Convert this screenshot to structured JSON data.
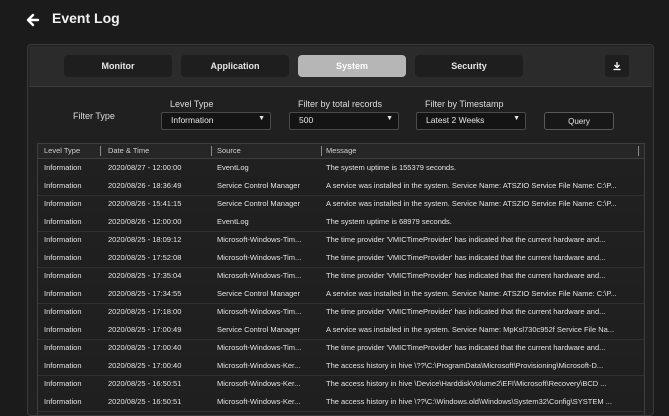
{
  "header": {
    "title": "Event Log"
  },
  "tabs": [
    {
      "label": "Monitor",
      "active": false
    },
    {
      "label": "Application",
      "active": false
    },
    {
      "label": "System",
      "active": true
    },
    {
      "label": "Security",
      "active": false
    }
  ],
  "filters": {
    "filter_type_label": "Filter Type",
    "level_type": {
      "label": "Level Type",
      "value": "Information"
    },
    "total_records": {
      "label": "Filter by total records",
      "value": "500"
    },
    "timestamp": {
      "label": "Filter by Timestamp",
      "value": "Latest 2 Weeks"
    },
    "query_label": "Query"
  },
  "table": {
    "columns": [
      "Level Type",
      "Date & Time",
      "Source",
      "Message"
    ],
    "rows": [
      [
        "Information",
        "2020/08/27 - 12:00:00",
        "EventLog",
        "The system uptime is 155379 seconds."
      ],
      [
        "Information",
        "2020/08/26 - 18:36:49",
        "Service Control Manager",
        "A service was installed in the system. Service Name: ATSZIO Service File Name: C:\\P..."
      ],
      [
        "Information",
        "2020/08/26 - 15:41:15",
        "Service Control Manager",
        "A service was installed in the system. Service Name: ATSZIO Service File Name: C:\\P..."
      ],
      [
        "Information",
        "2020/08/26 - 12:00:00",
        "EventLog",
        "The system uptime is 68979 seconds."
      ],
      [
        "Information",
        "2020/08/25 - 18:09:12",
        "Microsoft-Windows-Tim...",
        "The time provider 'VMICTimeProvider' has indicated that the current hardware and..."
      ],
      [
        "Information",
        "2020/08/25 - 17:52:08",
        "Microsoft-Windows-Tim...",
        "The time provider 'VMICTimeProvider' has indicated that the current hardware and..."
      ],
      [
        "Information",
        "2020/08/25 - 17:35:04",
        "Microsoft-Windows-Tim...",
        "The time provider 'VMICTimeProvider' has indicated that the current hardware and..."
      ],
      [
        "Information",
        "2020/08/25 - 17:34:55",
        "Service Control Manager",
        "A service was installed in the system. Service Name: ATSZIO Service File Name: C:\\P..."
      ],
      [
        "Information",
        "2020/08/25 - 17:18:00",
        "Microsoft-Windows-Tim...",
        "The time provider 'VMICTimeProvider' has indicated that the current hardware and..."
      ],
      [
        "Information",
        "2020/08/25 - 17:00:49",
        "Service Control Manager",
        "A service was installed in the system. Service Name: MpKsl730c952f Service File Na..."
      ],
      [
        "Information",
        "2020/08/25 - 17:00:40",
        "Microsoft-Windows-Tim...",
        "The time provider 'VMICTimeProvider' has indicated that the current hardware and..."
      ],
      [
        "Information",
        "2020/08/25 - 17:00:40",
        "Microsoft-Windows-Ker...",
        "The access history in hive \\??\\C:\\ProgramData\\Microsoft\\Provisioning\\Microsoft-D..."
      ],
      [
        "Information",
        "2020/08/25 - 16:50:51",
        "Microsoft-Windows-Ker...",
        "The access history in hive \\Device\\HarddiskVolume2\\EFI\\Microsoft\\Recovery\\BCD ..."
      ],
      [
        "Information",
        "2020/08/25 - 16:50:51",
        "Microsoft-Windows-Ker...",
        "The access history in hive \\??\\C:\\Windows.old\\Windows\\System32\\Config\\SYSTEM ..."
      ]
    ]
  }
}
